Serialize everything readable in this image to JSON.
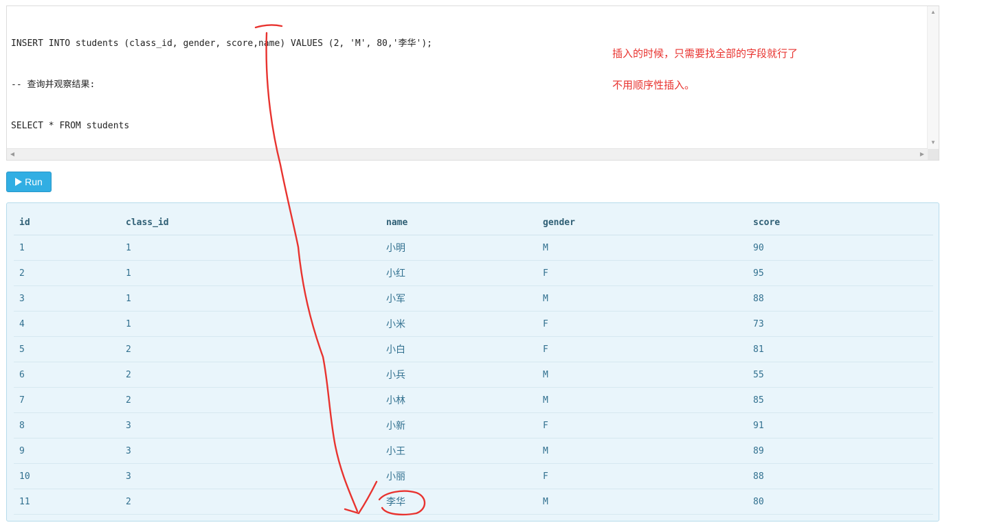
{
  "editor": {
    "lines": [
      "INSERT INTO students (class_id, gender, score,name) VALUES (2, 'M', 80,'李华');",
      "-- 查询并观察结果:",
      "SELECT * FROM students"
    ]
  },
  "annotations": {
    "note_line1": "插入的时候，只需要找全部的字段就行了",
    "note_line2": "不用顺序性插入。"
  },
  "run_button": {
    "label": "Run"
  },
  "result_table": {
    "columns": [
      "id",
      "class_id",
      "name",
      "gender",
      "score"
    ],
    "rows": [
      [
        "1",
        "1",
        "小明",
        "M",
        "90"
      ],
      [
        "2",
        "1",
        "小红",
        "F",
        "95"
      ],
      [
        "3",
        "1",
        "小军",
        "M",
        "88"
      ],
      [
        "4",
        "1",
        "小米",
        "F",
        "73"
      ],
      [
        "5",
        "2",
        "小白",
        "F",
        "81"
      ],
      [
        "6",
        "2",
        "小兵",
        "M",
        "55"
      ],
      [
        "7",
        "2",
        "小林",
        "M",
        "85"
      ],
      [
        "8",
        "3",
        "小新",
        "F",
        "91"
      ],
      [
        "9",
        "3",
        "小王",
        "M",
        "89"
      ],
      [
        "10",
        "3",
        "小丽",
        "F",
        "88"
      ],
      [
        "11",
        "2",
        "李华",
        "M",
        "80"
      ]
    ]
  },
  "colors": {
    "annotation_red": "#e8332f",
    "run_button": "#31aee3",
    "result_bg": "#e9f5fb",
    "result_text": "#31708f"
  }
}
